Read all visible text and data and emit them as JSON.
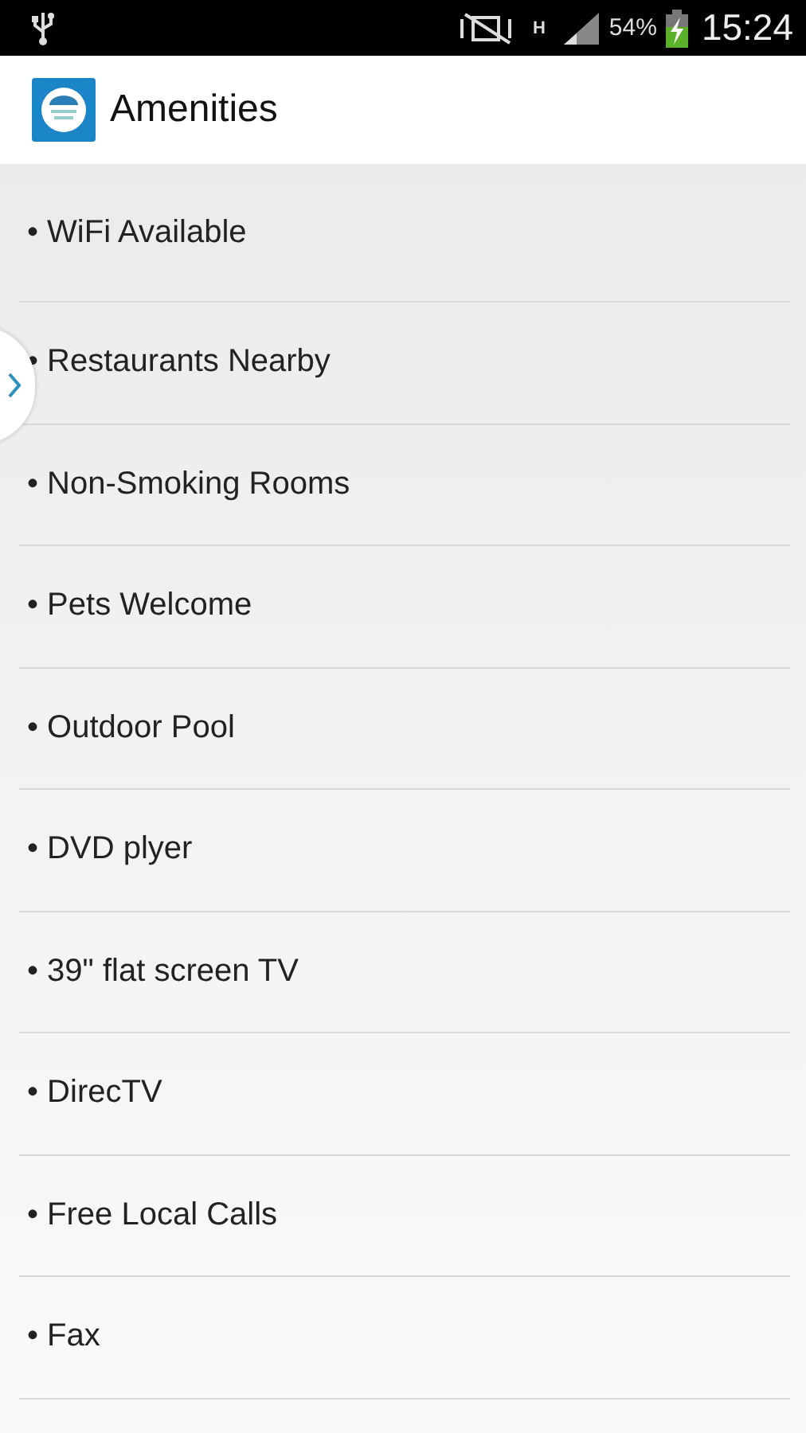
{
  "status_bar": {
    "network_type": "H",
    "battery_percent": "54%",
    "battery_charging": true,
    "time": "15:24"
  },
  "app_bar": {
    "title": "Amenities"
  },
  "drawer_handle": {
    "expanded": false
  },
  "amenities": [
    {
      "label": "• WiFi Available"
    },
    {
      "label": "• Restaurants Nearby"
    },
    {
      "label": "• Non-Smoking Rooms"
    },
    {
      "label": "• Pets Welcome"
    },
    {
      "label": "• Outdoor Pool"
    },
    {
      "label": "• DVD plyer"
    },
    {
      "label": "• 39\" flat screen TV"
    },
    {
      "label": "• DirecTV"
    },
    {
      "label": "• Free Local Calls"
    },
    {
      "label": "• Fax"
    }
  ]
}
